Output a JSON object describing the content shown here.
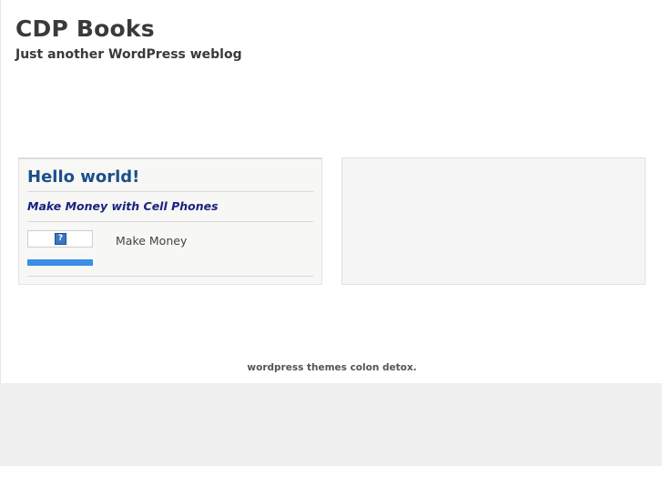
{
  "header": {
    "site_title": "CDP Books",
    "tagline": "Just another WordPress weblog"
  },
  "post": {
    "title": "Hello world!",
    "subtitle": "Make Money with Cell Phones",
    "ad_label": "Make Money",
    "ad_icon_glyph": "?"
  },
  "footer": {
    "credit": "wordpress themes colon detox."
  },
  "colors": {
    "post_title": "#1b4f8a",
    "subtitle": "#1a237e",
    "accent_bar": "#3a8ee6"
  }
}
